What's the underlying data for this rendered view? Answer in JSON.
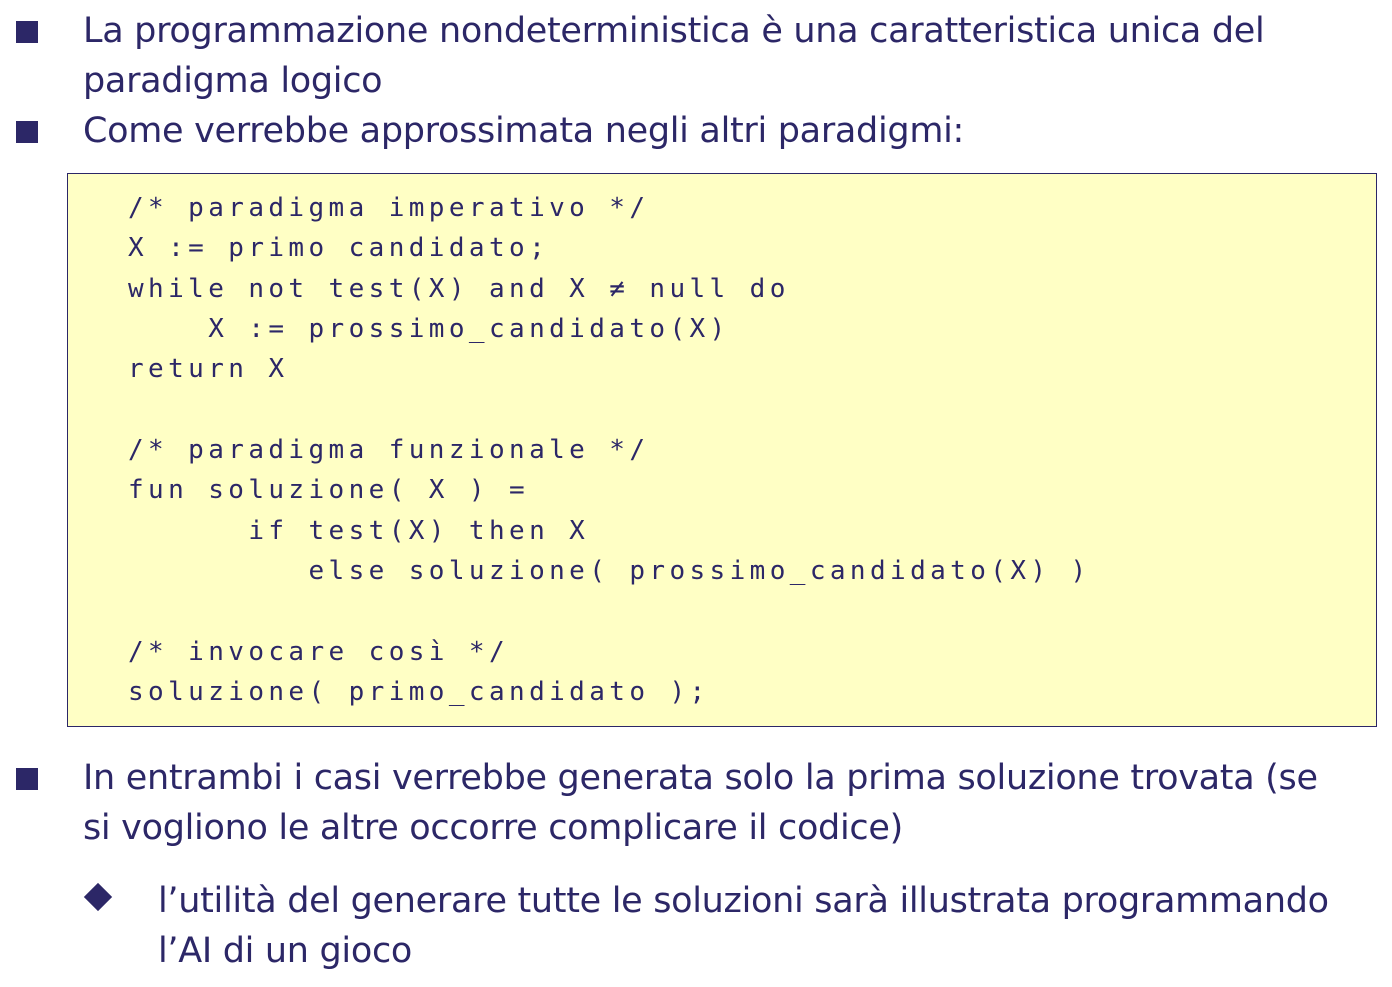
{
  "bullets": [
    {
      "lines": [
        "La programmazione nondeterministica è una caratteristica unica del",
        "paradigma logico"
      ]
    },
    {
      "lines": [
        "Come verrebbe approssimata negli altri paradigmi:"
      ]
    },
    {
      "lines": [
        "In entrambi i casi verrebbe generata solo la prima soluzione trovata (se",
        "si vogliono le altre occorre complicare il codice)"
      ]
    }
  ],
  "code": {
    "lines": [
      "/* paradigma imperativo */",
      "X := primo candidato;",
      "while not test(X) and X ≠ null do",
      "    X := prossimo_candidato(X)",
      "return X",
      "",
      "/* paradigma funzionale */",
      "fun soluzione( X ) =",
      "      if test(X) then X",
      "         else soluzione( prossimo_candidato(X) )",
      "",
      "/* invocare così */",
      "soluzione( primo_candidato );"
    ]
  },
  "sub_bullet": {
    "lines": [
      "l’utilità del generare tutte le soluzioni sarà illustrata programmando",
      "l’AI di un gioco"
    ]
  },
  "colors": {
    "text": "#2c2767",
    "code_background": "#ffffc5",
    "page_background": "#ffffff"
  },
  "icons": {
    "bullet": "square-bullet-icon",
    "sub_bullet": "diamond-bullet-icon"
  }
}
